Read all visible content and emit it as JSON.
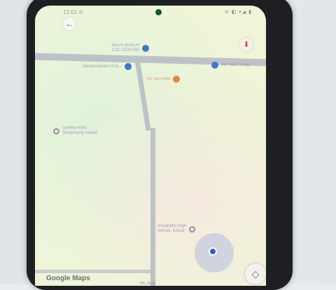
{
  "status_bar": {
    "time": "12:01 ⊘",
    "system_icons": "⊘ ◧ ▾◢ ▮"
  },
  "map": {
    "pois": [
      {
        "label_lines": [
          "BACK BENCH",
          "CSC CENTRE"
        ],
        "pin": "blue"
      },
      {
        "label_lines": [
          "Manjeswaram Post..."
        ],
        "pin": "blue"
      },
      {
        "label_lines": [
          "MP Tailor Shop"
        ],
        "pin": "blue"
      },
      {
        "label_lines": [
          "Sri Sai Hotel"
        ],
        "pin": "orange"
      },
      {
        "label_lines": [
          "Santha Hotel",
          "Temporarily closed"
        ],
        "pin": "grey"
      },
      {
        "label_lines": [
          "Hosabettu High",
          "School, Kuloor"
        ],
        "pin": "grey"
      }
    ],
    "bottom_road_label": "P.K. Store"
  },
  "branding": {
    "logo_text": "Google Maps"
  },
  "icons": {
    "back": "arrow-left-icon",
    "pin": "map-pin-icon",
    "navigate": "navigation-arrow-icon"
  }
}
